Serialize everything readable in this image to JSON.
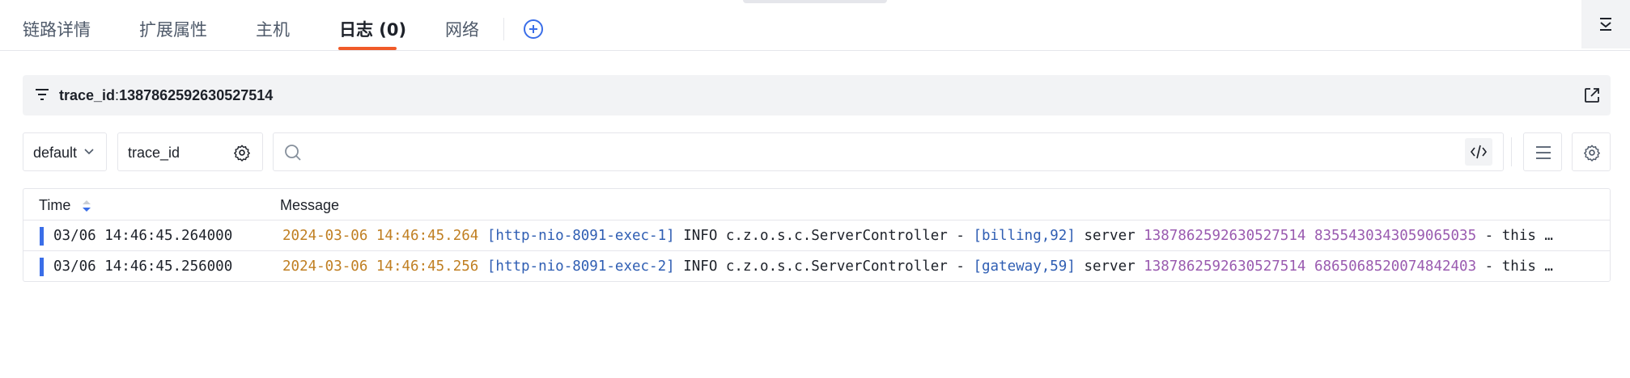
{
  "tabs": [
    {
      "label": "链路详情"
    },
    {
      "label": "扩展属性"
    },
    {
      "label": "主机"
    },
    {
      "label": "日志 (0)",
      "active": true
    },
    {
      "label": "网络"
    }
  ],
  "filter": {
    "key": "trace_id",
    "separator": ":",
    "value": "1387862592630527514"
  },
  "query": {
    "index_select": "default",
    "field_select": "trace_id",
    "search_placeholder": ""
  },
  "table": {
    "columns": [
      "Time",
      "Message"
    ],
    "rows": [
      {
        "time": "03/06 14:46:45.264000",
        "date": "2024-03-06 14:46:45.264",
        "thread": "[http-nio-8091-exec-1]",
        "level_class": "INFO c.z.o.s.c.ServerController -",
        "context": "[billing,92]",
        "word": "server",
        "trace_id": "1387862592630527514",
        "span_id": "8355430343059065035",
        "tail": "- this …"
      },
      {
        "time": "03/06 14:46:45.256000",
        "date": "2024-03-06 14:46:45.256",
        "thread": "[http-nio-8091-exec-2]",
        "level_class": "INFO c.z.o.s.c.ServerController -",
        "context": "[gateway,59]",
        "word": "server",
        "trace_id": "1387862592630527514",
        "span_id": "6865068520074842403",
        "tail": "- this …"
      }
    ]
  },
  "colors": {
    "accent": "#3a6ee8",
    "active_tab_underline": "#f05a28",
    "log_date": "#c07f22",
    "log_thread": "#2f5eb3",
    "log_id": "#9a5bb0"
  },
  "icons": {
    "add_tab": "plus-circle-icon",
    "collapse": "collapse-panel-icon",
    "filter": "filter-icon",
    "external": "external-link-icon",
    "search": "search-icon",
    "code": "code-icon",
    "list": "list-icon",
    "settings": "gear-icon"
  }
}
